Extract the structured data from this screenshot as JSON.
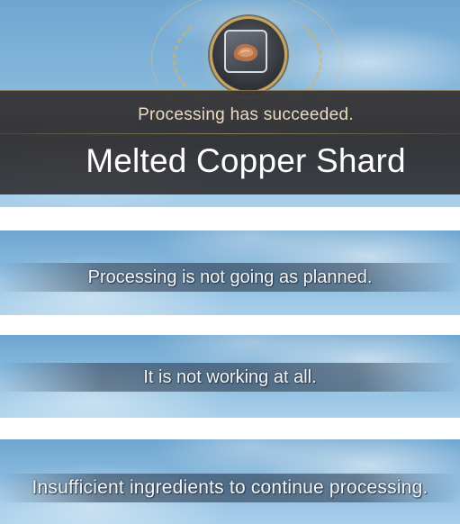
{
  "success_popup": {
    "status_text": "Processing has succeeded.",
    "item_name": "Melted Copper Shard",
    "item_icon": "copper-shard-icon"
  },
  "messages": [
    {
      "text": "Processing is not going as planned."
    },
    {
      "text": "It is not working at all."
    },
    {
      "text": "Insufficient ingredients to continue processing."
    }
  ],
  "colors": {
    "sky": "#8dbde0",
    "banner": "#2f2c2d",
    "gold_accent": "#caa35c",
    "status_text": "#eadbc0",
    "item_name": "#ffffff"
  }
}
